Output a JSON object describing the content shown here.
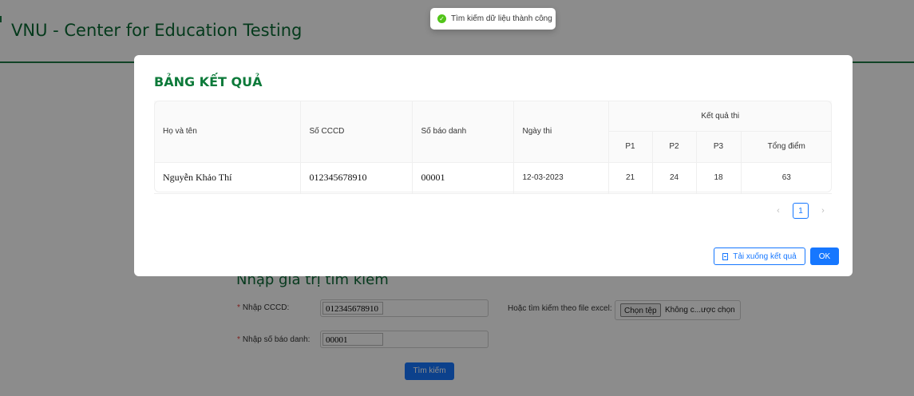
{
  "site": {
    "title": "VNU - Center for Education Testing"
  },
  "toast": {
    "message": "Tìm kiếm dữ liệu thành công",
    "icon": "check-circle-icon"
  },
  "search_form": {
    "title": "Nhập giá trị tìm kiếm",
    "cccd_label": "Nhập CCCD:",
    "cccd_value": "012345678910",
    "sbd_label": "Nhập số báo danh:",
    "sbd_value": "00001",
    "file_label": "Hoặc tìm kiếm theo file excel:",
    "file_button": "Chọn tệp",
    "file_status": "Không c...ược chọn",
    "search_button": "Tìm kiếm",
    "required_mark": "*"
  },
  "modal": {
    "title": "BẢNG KẾT QUẢ",
    "columns": {
      "name": "Họ và tên",
      "cccd": "Số CCCD",
      "sbd": "Số báo danh",
      "date": "Ngày thi",
      "result_group": "Kết quả thi",
      "p1": "P1",
      "p2": "P2",
      "p3": "P3",
      "total": "Tổng điểm"
    },
    "rows": [
      {
        "name": "Nguyễn Khảo Thí",
        "cccd": "012345678910",
        "sbd": "00001",
        "date": "12-03-2023",
        "p1": "21",
        "p2": "24",
        "p3": "18",
        "total": "63"
      }
    ],
    "pagination": {
      "prev": "‹",
      "current": "1",
      "next": "›"
    },
    "download_button": "Tải xuống kết quả",
    "ok_button": "OK"
  },
  "colors": {
    "brand_green": "#0d7a3a",
    "primary_blue": "#1677ff",
    "success_green": "#52c41a"
  }
}
